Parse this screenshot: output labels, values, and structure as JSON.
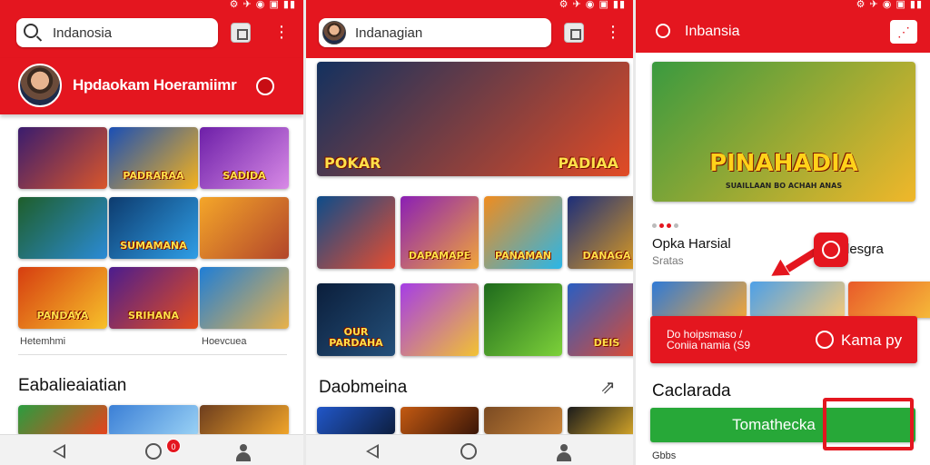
{
  "screens": [
    {
      "search": {
        "placeholder": "Indanosia"
      },
      "profile": {
        "name": "Hpdaokam Hoeramiimr"
      },
      "grid": [
        {
          "label": "",
          "colors": [
            "#3a1c6e",
            "#d9562b"
          ]
        },
        {
          "label": "PADRARAA",
          "colors": [
            "#1a4fb5",
            "#f5b21c"
          ]
        },
        {
          "label": "SADIDA",
          "colors": [
            "#6d1fa8",
            "#d88ae6"
          ]
        },
        {
          "label": "",
          "colors": [
            "#1e5e2a",
            "#2b8bd6"
          ]
        },
        {
          "label": "SUMAMANA",
          "colors": [
            "#0d3b6e",
            "#2f9ee6"
          ]
        },
        {
          "label": "",
          "colors": [
            "#f4a629",
            "#b2452a"
          ]
        },
        {
          "label": "PANDAYA",
          "colors": [
            "#d63d10",
            "#f7c12a"
          ]
        },
        {
          "label": "SRIHANA",
          "colors": [
            "#4b1c8e",
            "#e64e1d"
          ]
        },
        {
          "label": "",
          "colors": [
            "#1f7ed6",
            "#e8b14a"
          ]
        }
      ],
      "labels": {
        "left": "Hetemhmi",
        "right": "Hoevcuea"
      },
      "section": {
        "title": "Eabalieaiatian"
      },
      "bottom_tiles": [
        {
          "colors": [
            "#2a9d3f",
            "#e8421c"
          ]
        },
        {
          "colors": [
            "#3b7fd6",
            "#9ad2f5"
          ]
        },
        {
          "colors": [
            "#6d3d1e",
            "#f2a62a"
          ]
        }
      ],
      "nav": {
        "badge": "0"
      }
    },
    {
      "search": {
        "placeholder": "Indanagian"
      },
      "banner": {
        "left_text": "POKAR",
        "right_text": "PADIAA",
        "colors": [
          "#13315f",
          "#e14b25"
        ]
      },
      "row1": [
        {
          "label": "",
          "colors": [
            "#0d4c8a",
            "#e74d2f"
          ]
        },
        {
          "label": "DAPAMAPE",
          "colors": [
            "#8a1fb5",
            "#f0a53a"
          ]
        },
        {
          "label": "PANAMAN",
          "colors": [
            "#f08c1e",
            "#2ab6e8"
          ]
        },
        {
          "label": "DANAGA",
          "colors": [
            "#1c2e7a",
            "#e8a21c"
          ]
        }
      ],
      "row2": [
        {
          "label": "OUR PARDAHA",
          "colors": [
            "#0b1e3b",
            "#24507a"
          ]
        },
        {
          "label": "",
          "colors": [
            "#a53de6",
            "#f2c233"
          ]
        },
        {
          "label": "",
          "colors": [
            "#1e6a1c",
            "#7dd13a"
          ]
        },
        {
          "label": "DEIS",
          "colors": [
            "#2a5ec2",
            "#e84a2a"
          ]
        }
      ],
      "section": {
        "title": "Daobmeina",
        "arrow": "⇗"
      },
      "bottom_tiles": [
        {
          "colors": [
            "#2157c9",
            "#0d1e3f"
          ]
        },
        {
          "colors": [
            "#c45a12",
            "#3a1608"
          ]
        },
        {
          "colors": [
            "#7a4a22",
            "#c9853a"
          ]
        },
        {
          "colors": [
            "#1b1b1b",
            "#e8b42a"
          ]
        }
      ]
    },
    {
      "search": {
        "placeholder": "Inbansia"
      },
      "hero": {
        "title": "PINAHADIA",
        "subtitle": "SUAILLAAN BO ACHAH ANAS",
        "colors": [
          "#3a9a3f",
          "#f0b72a"
        ]
      },
      "game": {
        "title": "Opka Harsial",
        "subtitle": "Sratas",
        "side_text": "lesgra"
      },
      "thumbs": [
        {
          "colors": [
            "#2f7ad6",
            "#f0a53a"
          ]
        },
        {
          "colors": [
            "#4da0e8",
            "#f2c87a"
          ]
        },
        {
          "colors": [
            "#e85a2a",
            "#f7c23a"
          ]
        }
      ],
      "panel": {
        "line1": "Do hoipsmaso /",
        "line2": "Coniia namia (S9",
        "play_label": "Kama py"
      },
      "section": {
        "title": "Caclarada"
      },
      "install_button": {
        "label": "Tomathecka"
      },
      "footer": {
        "text": "Gbbs"
      },
      "colors": {
        "accent": "#e4161f",
        "green": "#27a838"
      }
    }
  ],
  "status_icons": "⚙ ✈ ◉ ▣ ▮▮"
}
